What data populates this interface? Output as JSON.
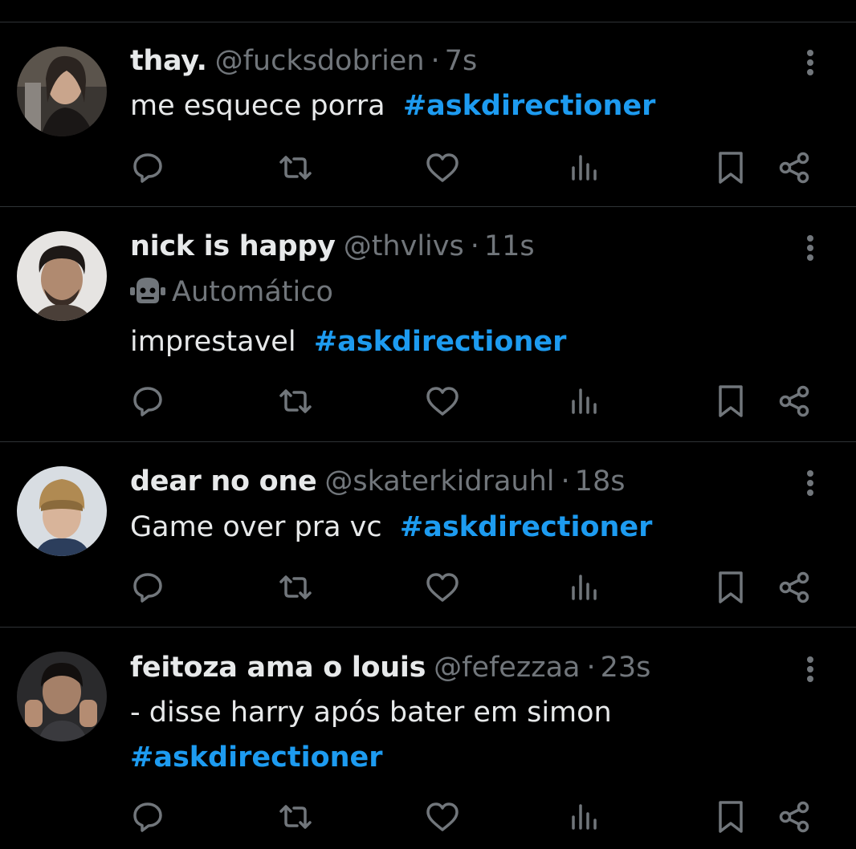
{
  "tweets": [
    {
      "display_name": "thay.",
      "handle": "@fucksdobrien",
      "separator": "·",
      "time": "7s",
      "automated_label": "",
      "text_before": "me esquece porra  ",
      "hashtag": "#askdirectioner",
      "avatar_icon": "avatar-photo"
    },
    {
      "display_name": "nick is happy",
      "handle": "@thvlivs",
      "separator": "·",
      "time": "11s",
      "automated_label": "Automático",
      "text_before": "imprestavel  ",
      "hashtag": "#askdirectioner",
      "avatar_icon": "avatar-photo"
    },
    {
      "display_name": "dear no one",
      "handle": "@skaterkidrauhl",
      "separator": "·",
      "time": "18s",
      "automated_label": "",
      "text_before": "Game over pra vc  ",
      "hashtag": "#askdirectioner",
      "avatar_icon": "avatar-photo"
    },
    {
      "display_name": "feitoza ama o louis",
      "handle": "@fefezzaa",
      "separator": "·",
      "time": "23s",
      "automated_label": "",
      "text_before": "- disse harry após bater em simon\n",
      "hashtag": "#askdirectioner",
      "avatar_icon": "avatar-photo"
    }
  ],
  "actions": [
    "reply-icon",
    "retweet-icon",
    "like-icon",
    "views-icon",
    "bookmark-icon",
    "share-icon"
  ],
  "colors": {
    "background": "#000000",
    "text": "#e7e9ea",
    "secondary": "#71767b",
    "accent": "#1d9bf0",
    "divider": "#2f3336"
  }
}
